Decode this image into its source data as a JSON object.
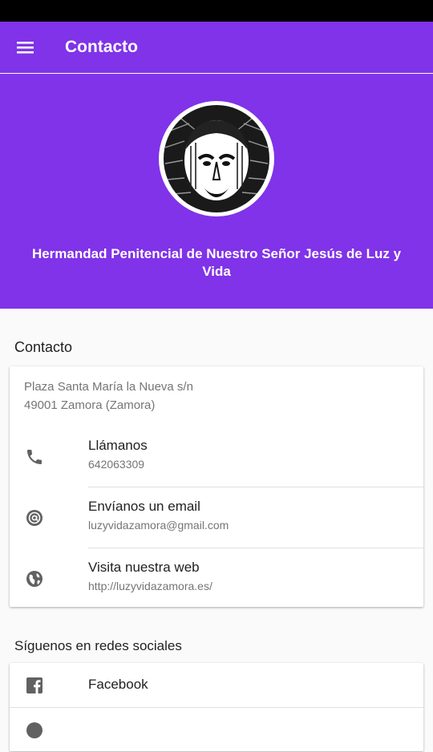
{
  "app_bar": {
    "title": "Contacto",
    "menu_icon": "menu-icon"
  },
  "hero": {
    "logo_icon": "jesus-face-logo",
    "org_name": "Hermandad Penitencial de Nuestro Señor Jesús de Luz y Vida"
  },
  "contact": {
    "section_title": "Contacto",
    "address": [
      "Plaza Santa María la Nueva s/n",
      "49001 Zamora (Zamora)"
    ],
    "items": [
      {
        "icon": "phone-icon",
        "title": "Llámanos",
        "subtitle": "642063309"
      },
      {
        "icon": "at-sign-icon",
        "title": "Envíanos un email",
        "subtitle": "luzyvidazamora@gmail.com"
      },
      {
        "icon": "globe-icon",
        "title": "Visita nuestra web",
        "subtitle": "http://luzyvidazamora.es/"
      }
    ]
  },
  "social": {
    "section_title": "Síguenos en redes sociales",
    "items": [
      {
        "icon": "facebook-icon",
        "label": "Facebook"
      }
    ]
  },
  "colors": {
    "primary": "#8033e8",
    "icon_gray": "#616161",
    "text_secondary": "#757575"
  }
}
